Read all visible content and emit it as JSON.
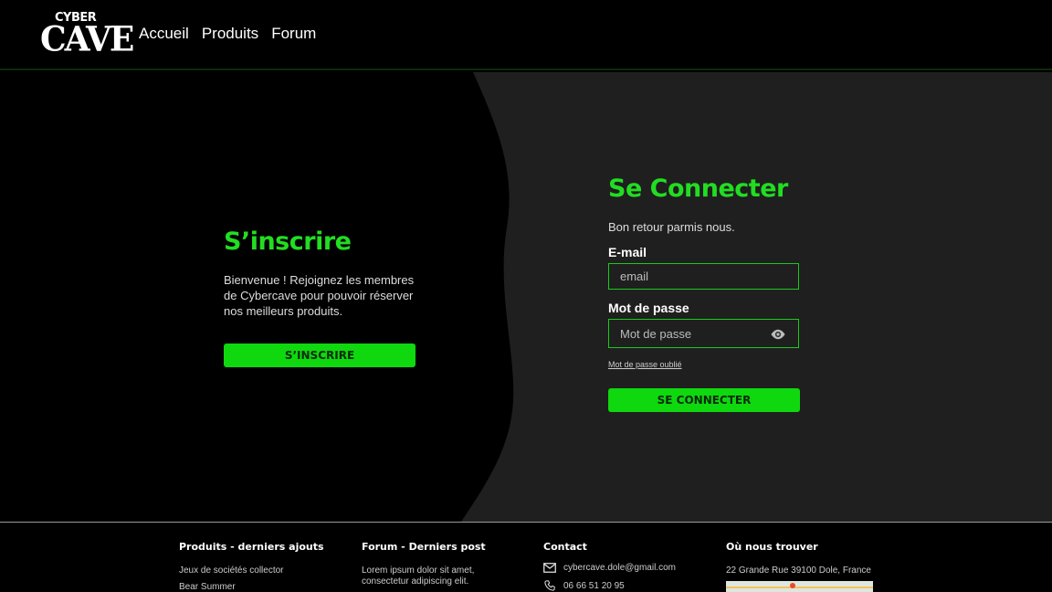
{
  "header": {
    "logo_top": "CYBER",
    "logo_bottom": "CAVE",
    "nav": [
      "Accueil",
      "Produits",
      "Forum"
    ]
  },
  "signup": {
    "title": "S’inscrire",
    "text": "Bienvenue ! Rejoignez les membres de Cybercave pour pouvoir réserver nos meilleurs produits.",
    "button": "S’INSCRIRE"
  },
  "login": {
    "title": "Se Connecter",
    "subtitle": "Bon retour parmis nous.",
    "email_label": "E-mail",
    "email_placeholder": "email",
    "password_label": "Mot de passe",
    "password_placeholder": "Mot de passe",
    "forgot": "Mot de passe oublié",
    "button": "SE CONNECTER"
  },
  "footer": {
    "products": {
      "title": "Produits - derniers ajouts",
      "items": [
        "Jeux de sociétés collector",
        "Bear Summer"
      ]
    },
    "forum": {
      "title": "Forum - Derniers post",
      "text": "Lorem ipsum dolor sit amet, consectetur adipiscing elit."
    },
    "contact": {
      "title": "Contact",
      "email": "cybercave.dole@gmail.com",
      "phone": "06 66 51 20 95"
    },
    "location": {
      "title": "Où nous trouver",
      "address": "22 Grande Rue 39100 Dole, France"
    }
  },
  "colors": {
    "accent": "#0fd80f",
    "title_green": "#22dd22",
    "panel_dark": "#1f1f1f"
  },
  "icons": [
    "eye-icon",
    "mail-icon",
    "phone-icon"
  ]
}
